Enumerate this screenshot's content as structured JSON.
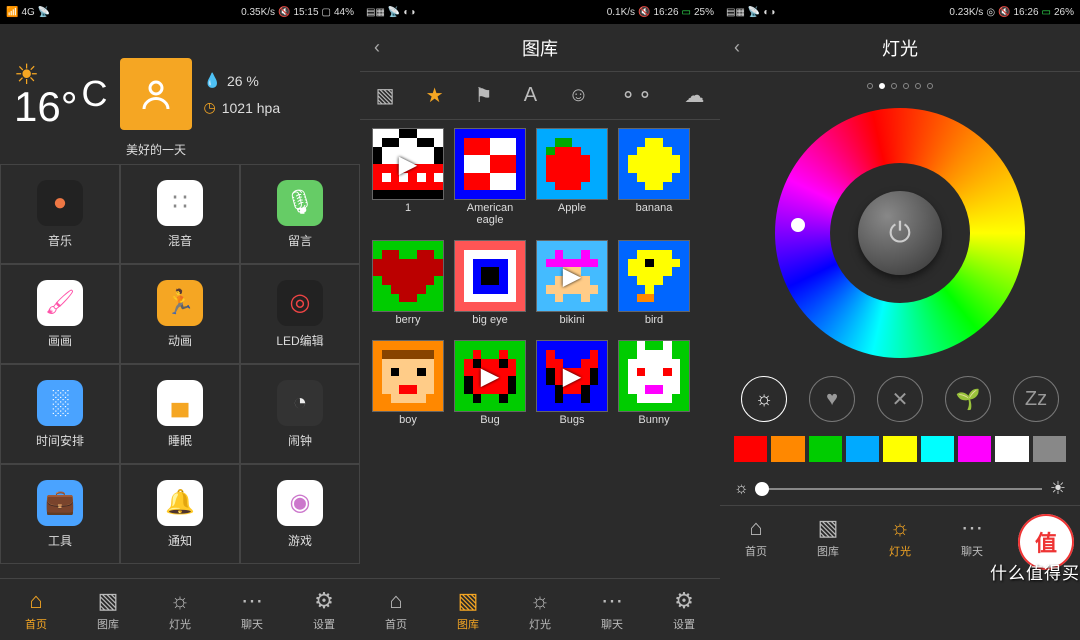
{
  "screen1": {
    "status": {
      "left": "4G",
      "speed": "0.35K/s",
      "time": "15:15",
      "battery": "44%"
    },
    "weather": {
      "temp": "16°",
      "unit": "C",
      "humidity": "26 %",
      "pressure": "1021 hpa",
      "caption": "美好的一天"
    },
    "apps": [
      {
        "label": "音乐",
        "icon": "●",
        "bg": "#222",
        "color": "#e74"
      },
      {
        "label": "混音",
        "icon": "∷",
        "bg": "#fff",
        "color": "#888"
      },
      {
        "label": "留言",
        "icon": "🎙",
        "bg": "#6c6",
        "color": "#fff"
      },
      {
        "label": "画画",
        "icon": "🖌",
        "bg": "#fff",
        "color": "#f5a"
      },
      {
        "label": "动画",
        "icon": "🏃",
        "bg": "#f5a623",
        "color": "#fff"
      },
      {
        "label": "LED编辑",
        "icon": "◎",
        "bg": "#222",
        "color": "#e44"
      },
      {
        "label": "时间安排",
        "icon": "░",
        "bg": "#4aa3ff",
        "color": "#fff"
      },
      {
        "label": "睡眠",
        "icon": "▄",
        "bg": "#fff",
        "color": "#f5a623"
      },
      {
        "label": "闹钟",
        "icon": "◔",
        "bg": "#333",
        "color": "#eee"
      },
      {
        "label": "工具",
        "icon": "💼",
        "bg": "#4aa3ff",
        "color": "#fff"
      },
      {
        "label": "通知",
        "icon": "🔔",
        "bg": "#fff",
        "color": "#888"
      },
      {
        "label": "游戏",
        "icon": "◉",
        "bg": "#fff",
        "color": "#c7c"
      }
    ],
    "nav": [
      {
        "label": "首页",
        "icon": "⌂",
        "active": true
      },
      {
        "label": "图库",
        "icon": "▧"
      },
      {
        "label": "灯光",
        "icon": "☼"
      },
      {
        "label": "聊天",
        "icon": "⋯"
      },
      {
        "label": "设置",
        "icon": "⚙"
      }
    ]
  },
  "screen2": {
    "status": {
      "speed": "0.1K/s",
      "time": "16:26",
      "battery": "25%"
    },
    "title": "图库",
    "categories": [
      {
        "icon": "▧"
      },
      {
        "icon": "★",
        "active": true
      },
      {
        "icon": "⚑"
      },
      {
        "icon": "A"
      },
      {
        "icon": "☺"
      },
      {
        "icon": "⚬⚬"
      },
      {
        "icon": "☁"
      }
    ],
    "items": [
      [
        {
          "label": "1",
          "play": true
        },
        {
          "label": "American eagle"
        },
        {
          "label": "Apple"
        },
        {
          "label": "banana"
        }
      ],
      [
        {
          "label": "berry"
        },
        {
          "label": "big eye"
        },
        {
          "label": "bikini",
          "play": true
        },
        {
          "label": "bird"
        }
      ],
      [
        {
          "label": "boy"
        },
        {
          "label": "Bug",
          "play": true
        },
        {
          "label": "Bugs",
          "play": true
        },
        {
          "label": "Bunny"
        }
      ]
    ],
    "nav": [
      {
        "label": "首页",
        "icon": "⌂"
      },
      {
        "label": "图库",
        "icon": "▧",
        "active": true
      },
      {
        "label": "灯光",
        "icon": "☼"
      },
      {
        "label": "聊天",
        "icon": "⋯"
      },
      {
        "label": "设置",
        "icon": "⚙"
      }
    ]
  },
  "screen3": {
    "status": {
      "speed": "0.23K/s",
      "time": "16:26",
      "battery": "26%"
    },
    "title": "灯光",
    "pages": 6,
    "page_active": 1,
    "modes": [
      {
        "icon": "☼",
        "active": true
      },
      {
        "icon": "♥"
      },
      {
        "icon": "✕"
      },
      {
        "icon": "🌱"
      },
      {
        "icon": "Zz"
      }
    ],
    "swatches": [
      "#f00",
      "#f80",
      "#0c0",
      "#0af",
      "#ff0",
      "#0ff",
      "#f0f",
      "#fff",
      "#888"
    ],
    "nav": [
      {
        "label": "首页",
        "icon": "⌂"
      },
      {
        "label": "图库",
        "icon": "▧"
      },
      {
        "label": "灯光",
        "icon": "☼",
        "active": true
      },
      {
        "label": "聊天",
        "icon": "⋯"
      },
      {
        "label": "设置",
        "icon": "⚙"
      }
    ],
    "watermark": "值",
    "watermark_text": "什么值得买"
  }
}
